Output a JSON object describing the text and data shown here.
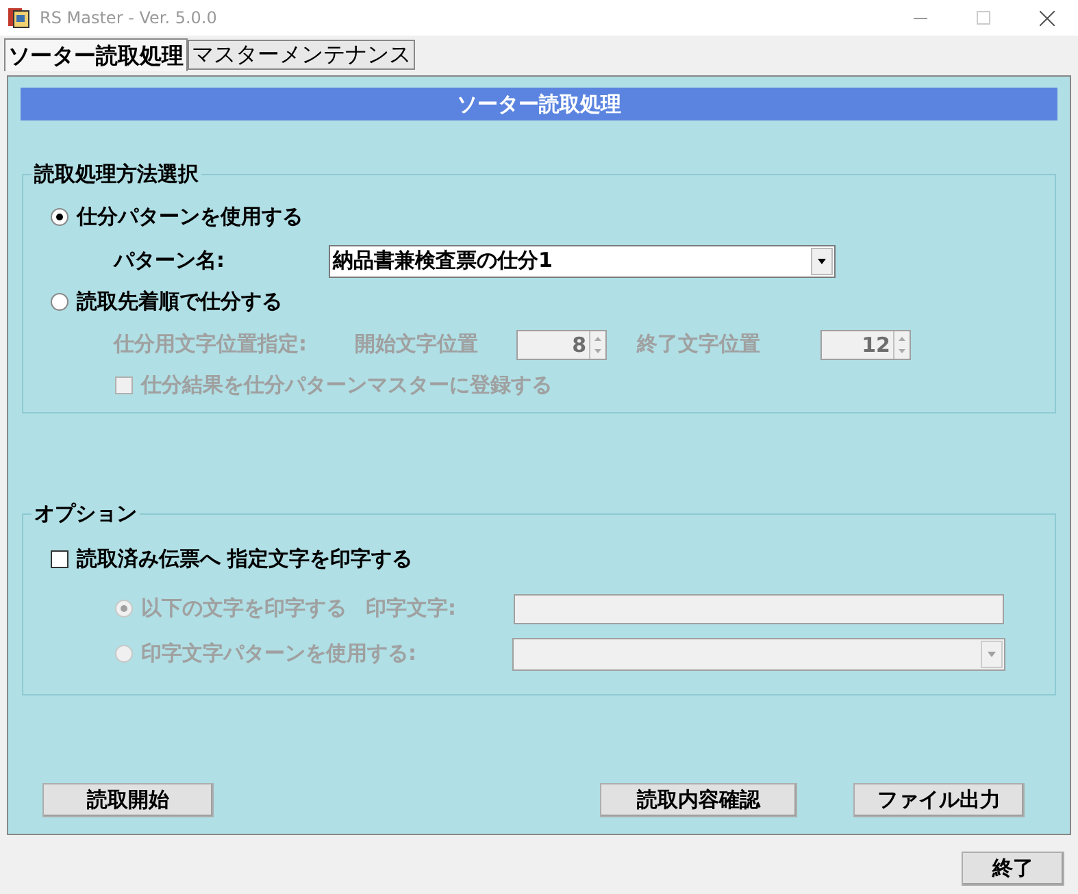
{
  "window": {
    "title": "RS Master - Ver. 5.0.0"
  },
  "tabs": [
    {
      "label": "ソーター読取処理",
      "selected": true
    },
    {
      "label": "マスターメンテナンス",
      "selected": false
    }
  ],
  "header": {
    "title": "ソーター読取処理"
  },
  "method": {
    "legend": "読取処理方法選択",
    "pattern": {
      "label": "仕分パターンを使用する",
      "selected": true,
      "field_label": "パターン名:",
      "value": "納品書兼検査票の仕分1"
    },
    "order": {
      "label": "読取先着順で仕分する",
      "selected": false,
      "disabled": true,
      "position_label": "仕分用文字位置指定:",
      "start_label": "開始文字位置",
      "start_value": "8",
      "end_label": "終了文字位置",
      "end_value": "12",
      "register": {
        "label": "仕分結果を仕分パターンマスターに登録する",
        "checked": false
      }
    }
  },
  "options": {
    "legend": "オプション",
    "print": {
      "label": "読取済み伝票へ 指定文字を印字する",
      "checked": false
    },
    "choices": [
      {
        "kind": "text",
        "label": "以下の文字を印字する",
        "selected": true,
        "disabled": true,
        "field_label": "印字文字:"
      },
      {
        "kind": "dropdown",
        "label": "印字文字パターンを使用する:",
        "selected": false,
        "disabled": true
      }
    ]
  },
  "buttons_left": [
    "読取開始"
  ],
  "buttons_right": [
    "読取内容確認",
    "ファイル出力"
  ],
  "exit_button": "終了"
}
